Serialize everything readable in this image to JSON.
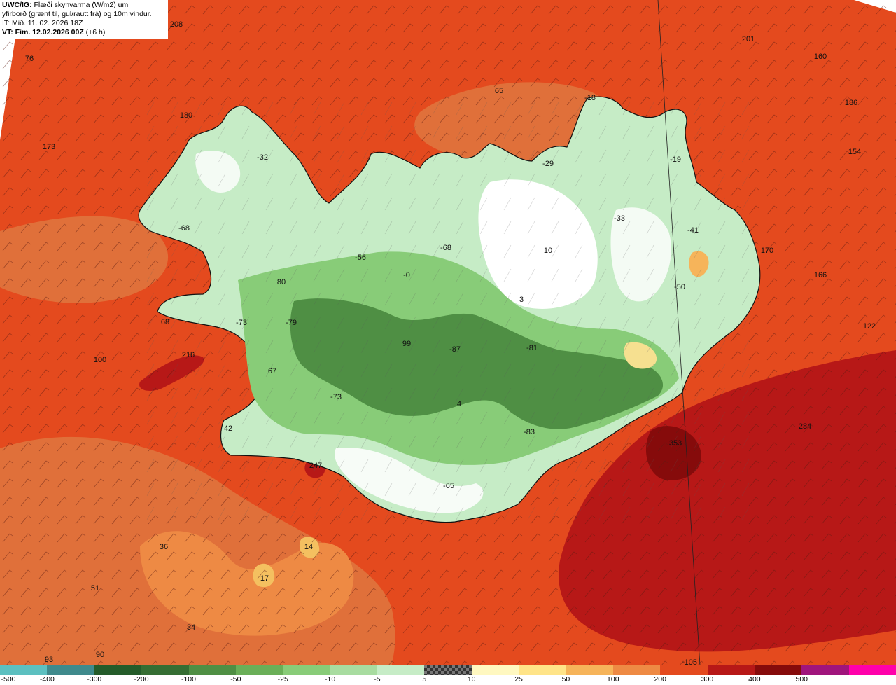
{
  "header": {
    "line1_bold": "UWC/IG:",
    "line1_rest": " Flæði skynvarma (W/m2) um",
    "line2": "yfirborð (grænt til, gul/rautt frá) og 10m vindur.",
    "line3": "IT: Mið. 11. 02. 2026 18Z",
    "line4_bold": "VT: Fim. 12.02.2026 00Z",
    "line4_rest": " (+6 h)"
  },
  "palette": {
    "ocean": "#e44a1e",
    "ocean_light": "#e0703a",
    "ocean_orange": "#ee8a44",
    "ocean_yellow": "#f4c060",
    "ocean_dark": "#b71817",
    "ocean_darker": "#860b0b",
    "land_light": "#c6ecc6",
    "land_mid": "#88cc78",
    "land_dark": "#4f8f44",
    "land_white": "#ffffff",
    "coast": "#111111"
  },
  "map_values": [
    {
      "text": "208"
    },
    {
      "text": "76"
    },
    {
      "text": "201"
    },
    {
      "text": "160"
    },
    {
      "text": "186"
    },
    {
      "text": "154"
    },
    {
      "text": "180"
    },
    {
      "text": "173"
    },
    {
      "text": "65"
    },
    {
      "text": "-18"
    },
    {
      "text": "-32"
    },
    {
      "text": "-29"
    },
    {
      "text": "-19"
    },
    {
      "text": "-33"
    },
    {
      "text": "-41"
    },
    {
      "text": "-68"
    },
    {
      "text": "-68"
    },
    {
      "text": "-56"
    },
    {
      "text": "10"
    },
    {
      "text": "170"
    },
    {
      "text": "166"
    },
    {
      "text": "80"
    },
    {
      "text": "-0"
    },
    {
      "text": "-50"
    },
    {
      "text": "3"
    },
    {
      "text": "68"
    },
    {
      "text": "-73"
    },
    {
      "text": "-79"
    },
    {
      "text": "122"
    },
    {
      "text": "99"
    },
    {
      "text": "-87"
    },
    {
      "text": "-81"
    },
    {
      "text": "100"
    },
    {
      "text": "216"
    },
    {
      "text": "67"
    },
    {
      "text": "-73"
    },
    {
      "text": "4"
    },
    {
      "text": "284"
    },
    {
      "text": "42"
    },
    {
      "text": "-83"
    },
    {
      "text": "353"
    },
    {
      "text": "247"
    },
    {
      "text": "-65"
    },
    {
      "text": "36"
    },
    {
      "text": "14"
    },
    {
      "text": "17"
    },
    {
      "text": "51"
    },
    {
      "text": "34"
    },
    {
      "text": "90"
    },
    {
      "text": "93"
    },
    {
      "text": "-105"
    }
  ],
  "colorbar": {
    "labels": [
      "-500",
      "-400",
      "-300",
      "-200",
      "-100",
      "-50",
      "-25",
      "-10",
      "-5",
      "5",
      "10",
      "25",
      "50",
      "100",
      "200",
      "300",
      "400",
      "500"
    ],
    "colors": [
      "#5cc0c0",
      "#3f8a8c",
      "#245c2a",
      "#356e33",
      "#4f8f44",
      "#6aaf58",
      "#88cc78",
      "#a8dca0",
      "#c6ecc6",
      "checker",
      "#fff8c0",
      "#ffe488",
      "#f6b45a",
      "#ee8a44",
      "#e44a1e",
      "#b71817",
      "#860b0b",
      "#a0147c",
      "#ff00aa"
    ]
  }
}
